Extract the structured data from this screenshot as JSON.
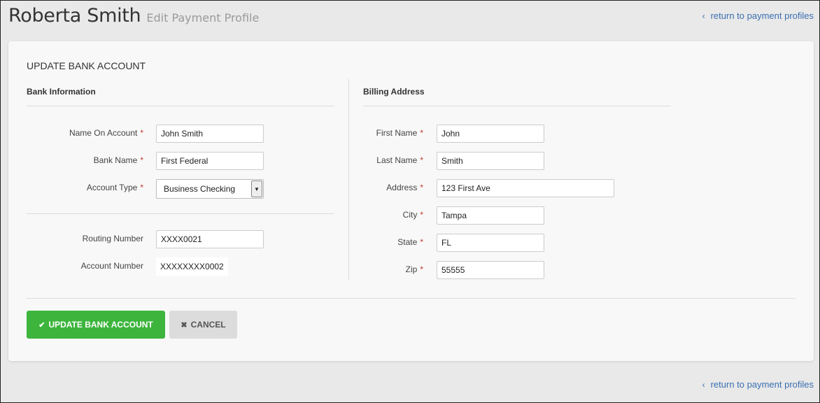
{
  "header": {
    "user_name": "Roberta Smith",
    "subtitle": "Edit Payment Profile",
    "return_link": "return to payment profiles",
    "return_chevron": "‹"
  },
  "form": {
    "title": "UPDATE BANK ACCOUNT",
    "required_marker": "*",
    "bank": {
      "heading": "Bank Information",
      "name_on_account": {
        "label": "Name On Account",
        "value": "John Smith"
      },
      "bank_name": {
        "label": "Bank Name",
        "value": "First Federal"
      },
      "account_type": {
        "label": "Account Type",
        "value": "Business Checking"
      },
      "routing_number": {
        "label": "Routing Number",
        "value": "XXXX0021"
      },
      "account_number": {
        "label": "Account Number",
        "value": "XXXXXXXX0002"
      }
    },
    "billing": {
      "heading": "Billing Address",
      "first_name": {
        "label": "First Name",
        "value": "John"
      },
      "last_name": {
        "label": "Last Name",
        "value": "Smith"
      },
      "address": {
        "label": "Address",
        "value": "123 First Ave"
      },
      "city": {
        "label": "City",
        "value": "Tampa"
      },
      "state": {
        "label": "State",
        "value": "FL"
      },
      "zip": {
        "label": "Zip",
        "value": "55555"
      }
    },
    "actions": {
      "update_label": "UPDATE BANK ACCOUNT",
      "cancel_label": "CANCEL"
    }
  },
  "colors": {
    "primary_button": "#3db53d",
    "link": "#3a6fb0",
    "required": "#c0392b"
  }
}
